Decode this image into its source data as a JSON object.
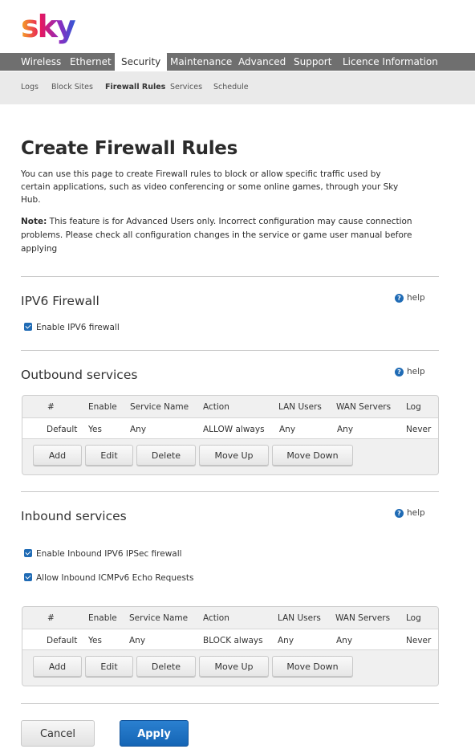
{
  "brand": {
    "logo_text": "sky"
  },
  "mainnav": [
    "Wireless",
    "Ethernet",
    "Security",
    "Maintenance",
    "Advanced",
    "Support",
    "Licence Information"
  ],
  "mainnav_active": "Security",
  "subnav": [
    "Logs",
    "Block Sites",
    "Firewall Rules",
    "Services",
    "Schedule"
  ],
  "subnav_active": "Firewall Rules",
  "page": {
    "title": "Create Firewall Rules",
    "description": "You can use this page to create Firewall rules to block or allow specific traffic used by certain applications, such as video conferencing or some online games, through your Sky Hub.",
    "note_label": "Note:",
    "note_text": " This feature is for Advanced Users only. Incorrect configuration may cause connection problems. Please check all configuration changes in the service or game user manual before applying"
  },
  "help_label": "help",
  "ipv6": {
    "title": "IPV6 Firewall",
    "enable_label": "Enable IPV6 firewall",
    "enabled": true
  },
  "table_headers": [
    "#",
    "Enable",
    "Service Name",
    "Action",
    "LAN Users",
    "WAN Servers",
    "Log"
  ],
  "outbound": {
    "title": "Outbound services",
    "row": [
      "Default",
      "Yes",
      "Any",
      "ALLOW always",
      "Any",
      "Any",
      "Never"
    ]
  },
  "inbound": {
    "title": "Inbound services",
    "ipsec_label": "Enable Inbound IPV6 IPSec firewall",
    "ipsec_enabled": true,
    "icmp_label": "Allow Inbound ICMPv6 Echo Requests",
    "icmp_enabled": true,
    "row": [
      "Default",
      "Yes",
      "Any",
      "BLOCK always",
      "Any",
      "Any",
      "Never"
    ]
  },
  "table_buttons": [
    "Add",
    "Edit",
    "Delete",
    "Move Up",
    "Move Down"
  ],
  "footer": {
    "cancel": "Cancel",
    "apply": "Apply"
  },
  "colors": {
    "nav_bg": "#6f6f6f",
    "accent": "#1f6bb5",
    "subnav_bg": "#eaeaea"
  }
}
